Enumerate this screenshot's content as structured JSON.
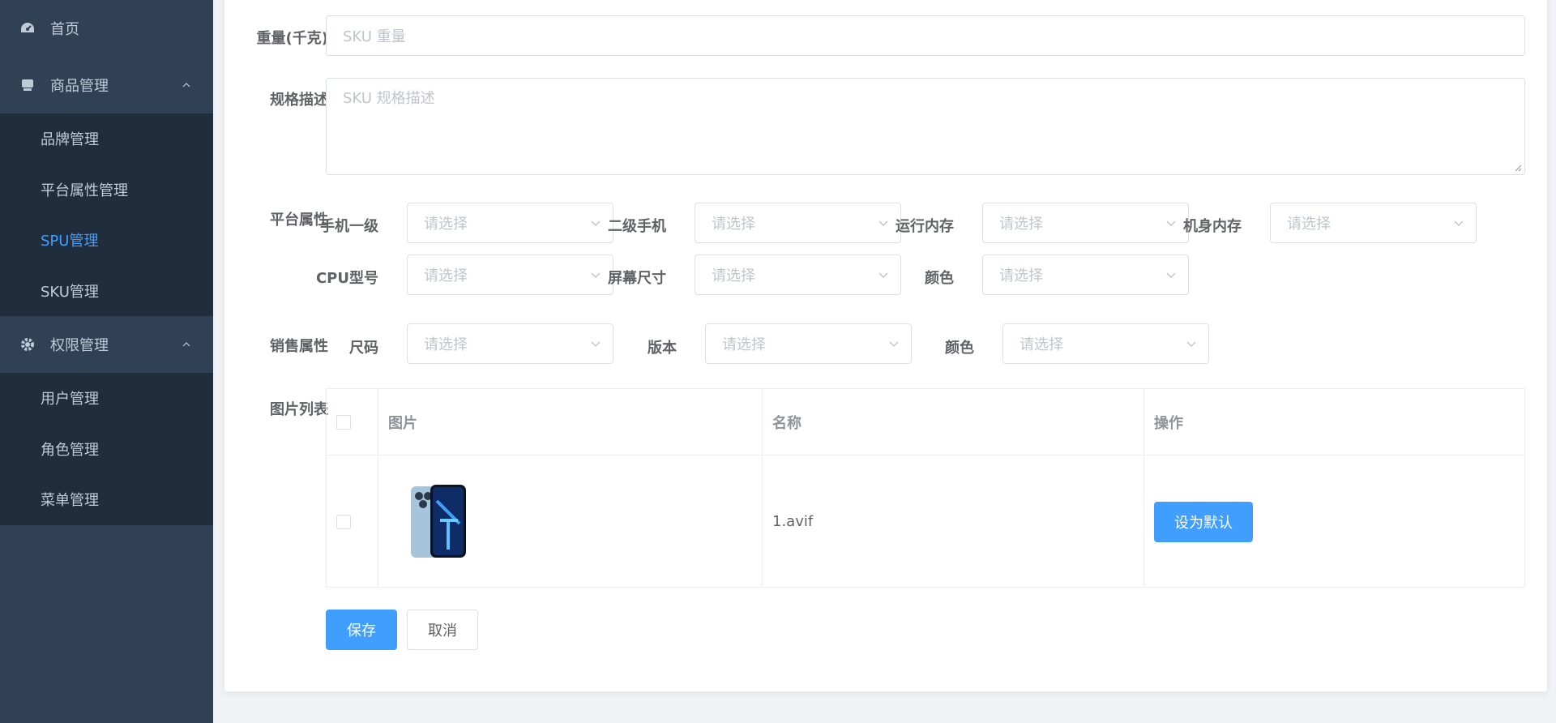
{
  "sidebar": {
    "home": "首页",
    "product": {
      "label": "商品管理",
      "items": [
        "品牌管理",
        "平台属性管理",
        "SPU管理",
        "SKU管理"
      ]
    },
    "permission": {
      "label": "权限管理",
      "items": [
        "用户管理",
        "角色管理",
        "菜单管理"
      ]
    }
  },
  "form": {
    "weight_label": "重量(千克)",
    "weight_placeholder": "SKU 重量",
    "desc_label": "规格描述",
    "desc_placeholder": "SKU 规格描述",
    "platform_label": "平台属性",
    "platform_attrs": [
      {
        "label": "手机一级",
        "placeholder": "请选择"
      },
      {
        "label": "二级手机",
        "placeholder": "请选择"
      },
      {
        "label": "运行内存",
        "placeholder": "请选择"
      },
      {
        "label": "机身内存",
        "placeholder": "请选择"
      },
      {
        "label": "CPU型号",
        "placeholder": "请选择"
      },
      {
        "label": "屏幕尺寸",
        "placeholder": "请选择"
      },
      {
        "label": "颜色",
        "placeholder": "请选择"
      }
    ],
    "sale_label": "销售属性",
    "sale_attrs": [
      {
        "label": "尺码",
        "placeholder": "请选择"
      },
      {
        "label": "版本",
        "placeholder": "请选择"
      },
      {
        "label": "颜色",
        "placeholder": "请选择"
      }
    ],
    "image_label": "图片列表",
    "table": {
      "headers": [
        "图片",
        "名称",
        "操作"
      ],
      "rows": [
        {
          "name": "1.avif",
          "action": "设为默认"
        }
      ]
    },
    "save": "保存",
    "cancel": "取消"
  },
  "colors": {
    "sidebar_bg": "#304156",
    "submenu_bg": "#1f2d3d",
    "active": "#409eff",
    "primary": "#409eff"
  }
}
